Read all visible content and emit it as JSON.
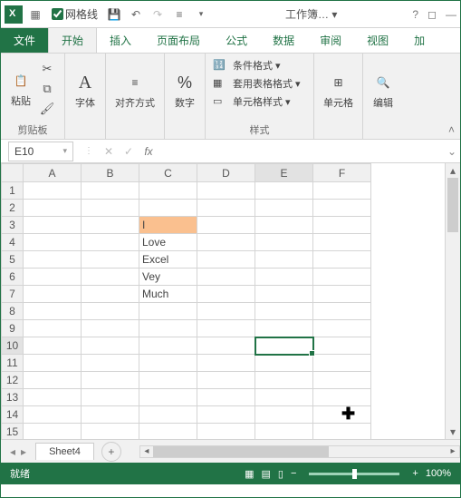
{
  "titlebar": {
    "gridlines_label": "网格线",
    "doc_title": "工作簿… ▾",
    "help": "?",
    "restore": "◻",
    "minimize": "—"
  },
  "tabs": {
    "file": "文件",
    "home": "开始",
    "insert": "插入",
    "layout": "页面布局",
    "formula": "公式",
    "data": "数据",
    "review": "审阅",
    "view": "视图",
    "extra": "加"
  },
  "ribbon": {
    "clipboard": {
      "paste": "粘贴",
      "label": "剪贴板"
    },
    "font": {
      "label": "字体"
    },
    "align": {
      "label": "对齐方式"
    },
    "number": {
      "label": "数字",
      "percent": "%"
    },
    "styles": {
      "cond": "条件格式 ▾",
      "table": "套用表格格式 ▾",
      "cell": "单元格样式 ▾",
      "label": "样式"
    },
    "cells": {
      "label": "单元格"
    },
    "editing": {
      "label": "编辑"
    }
  },
  "formula_bar": {
    "name_box": "E10",
    "fx": "fx"
  },
  "grid": {
    "cols": [
      "A",
      "B",
      "C",
      "D",
      "E",
      "F"
    ],
    "rows": [
      "1",
      "2",
      "3",
      "4",
      "5",
      "6",
      "7",
      "8",
      "9",
      "10",
      "11",
      "12",
      "13",
      "14",
      "15"
    ],
    "cells": {
      "C3": "I",
      "C4": "Love",
      "C5": "Excel",
      "C6": "Vey",
      "C7": "Much"
    },
    "highlight": "C3",
    "selected": "E10"
  },
  "sheet": {
    "name": "Sheet4",
    "add": "+"
  },
  "status": {
    "ready": "就绪",
    "zoom": "100%"
  }
}
